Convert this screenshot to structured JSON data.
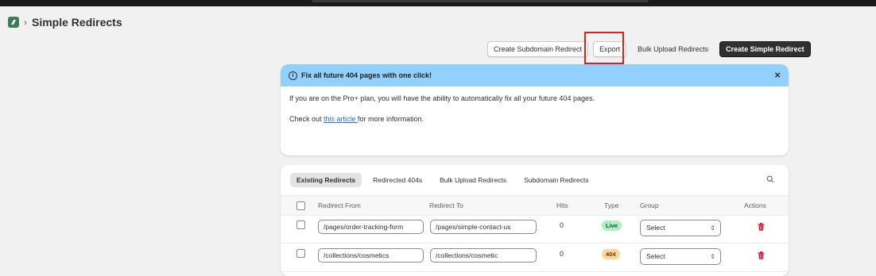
{
  "header": {
    "title": "Simple Redirects",
    "app_icon": "app-logo-icon"
  },
  "actions": {
    "create_subdomain": "Create Subdomain Redirect",
    "export": "Export",
    "bulk_upload": "Bulk Upload Redirects",
    "create_simple": "Create Simple Redirect"
  },
  "banner": {
    "title": "Fix all future 404 pages with one click!",
    "body": "If you are on the Pro+ plan, you will have the ability to automatically fix all your future 404 pages.",
    "check_prefix": "Check out ",
    "link_text": "this article ",
    "check_suffix": "for more information.",
    "close": "×",
    "info": "i"
  },
  "tabs": [
    {
      "label": "Existing Redirects",
      "active": true
    },
    {
      "label": "Redirected 404s"
    },
    {
      "label": "Bulk Upload Redirects"
    },
    {
      "label": "Subdomain Redirects"
    }
  ],
  "table": {
    "columns": {
      "from": "Redirect From",
      "to": "Redirect To",
      "hits": "Hits",
      "type": "Type",
      "group": "Group",
      "actions": "Actions"
    },
    "rows": [
      {
        "from": "/pages/order-tracking-form",
        "to": "/pages/simple-contact-us",
        "hits": "0",
        "type": "Live",
        "group": "Select"
      },
      {
        "from": "/collections/cosmetics",
        "to": "/collections/cosmetic",
        "hits": "0",
        "type": "404",
        "group": "Select"
      }
    ]
  },
  "colors": {
    "banner_bg": "#91d0ff",
    "live_badge": "#aff1c3",
    "notfound_badge": "#ffd79d",
    "trash": "#c70a24",
    "highlight": "#e01e1e"
  }
}
